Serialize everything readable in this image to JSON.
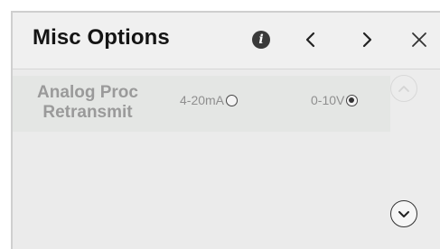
{
  "header": {
    "title": "Misc Options",
    "info_icon": "info-icon",
    "prev_icon": "chevron-left-icon",
    "next_icon": "chevron-right-icon",
    "close_icon": "close-icon"
  },
  "setting": {
    "label_line1": "Analog Proc",
    "label_line2": "Retransmit",
    "options": [
      {
        "label": "4-20mA",
        "selected": false
      },
      {
        "label": "0-10V",
        "selected": true
      }
    ]
  },
  "scroll": {
    "up_icon": "chevron-up-icon",
    "down_icon": "chevron-down-icon",
    "up_enabled": false,
    "down_enabled": true
  },
  "colors": {
    "panel_bg": "#f1f1f1",
    "row_bg": "#e4e6e4",
    "label_gray": "#9a9a9a",
    "icon_dark": "#333333"
  }
}
